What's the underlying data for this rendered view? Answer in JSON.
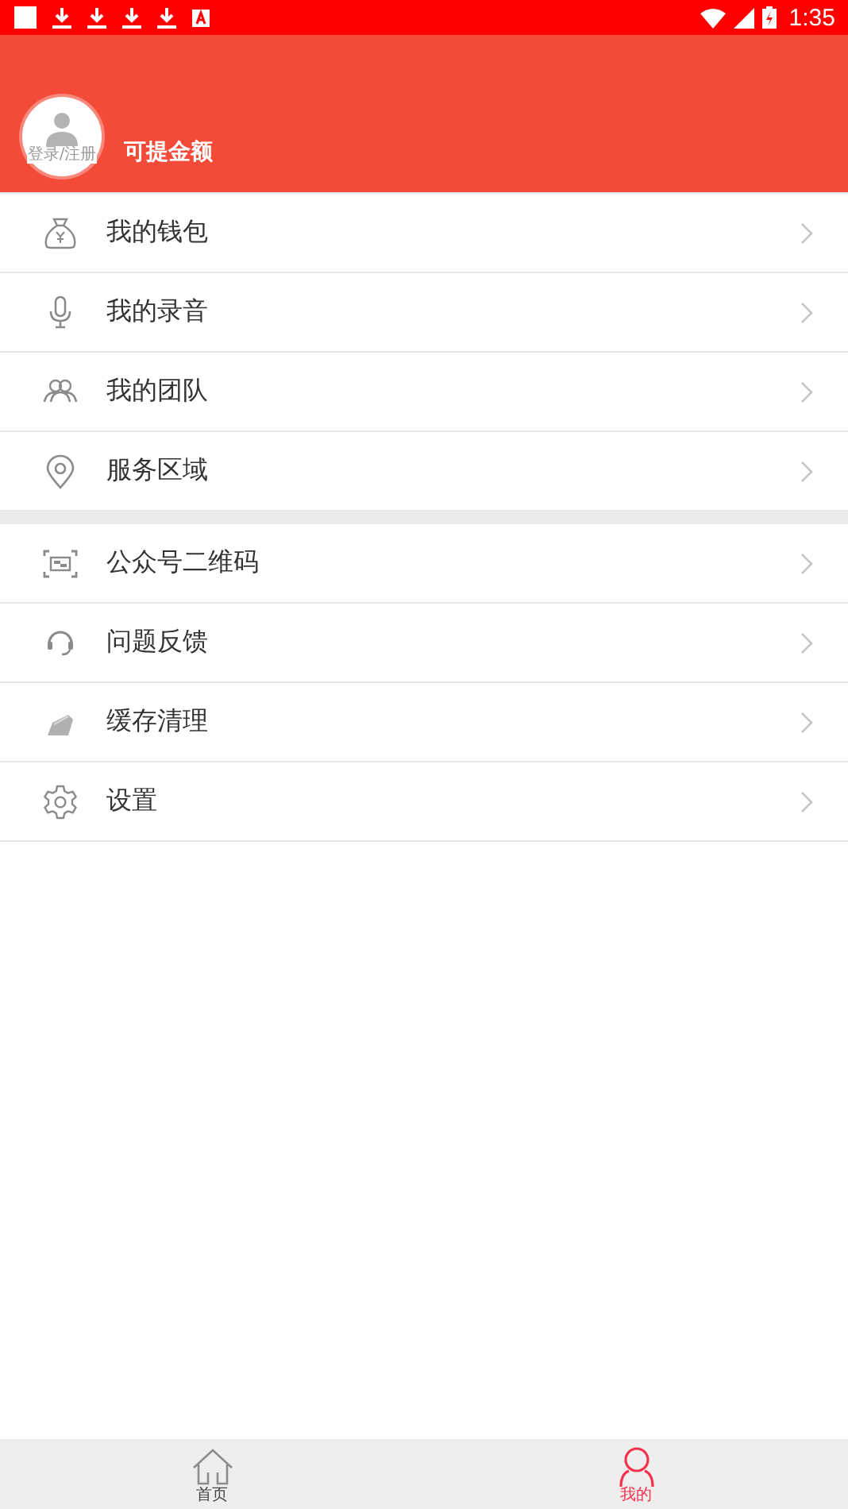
{
  "status_bar": {
    "time": "1:35"
  },
  "header": {
    "avatar_caption": "登录/注册",
    "balance_label": "可提金额"
  },
  "menu_groups": [
    {
      "items": [
        {
          "label": "我的钱包",
          "kind": "wallet"
        },
        {
          "label": "我的录音",
          "kind": "mic"
        },
        {
          "label": "我的团队",
          "kind": "team"
        },
        {
          "label": "服务区域",
          "kind": "pin"
        }
      ]
    },
    {
      "items": [
        {
          "label": "公众号二维码",
          "kind": "qr"
        },
        {
          "label": "问题反馈",
          "kind": "headset"
        },
        {
          "label": "缓存清理",
          "kind": "broom"
        },
        {
          "label": "设置",
          "kind": "gear"
        }
      ]
    }
  ],
  "bottom_nav": [
    {
      "label": "首页",
      "kind": "home",
      "selected": false
    },
    {
      "label": "我的",
      "kind": "person",
      "selected": true
    }
  ]
}
